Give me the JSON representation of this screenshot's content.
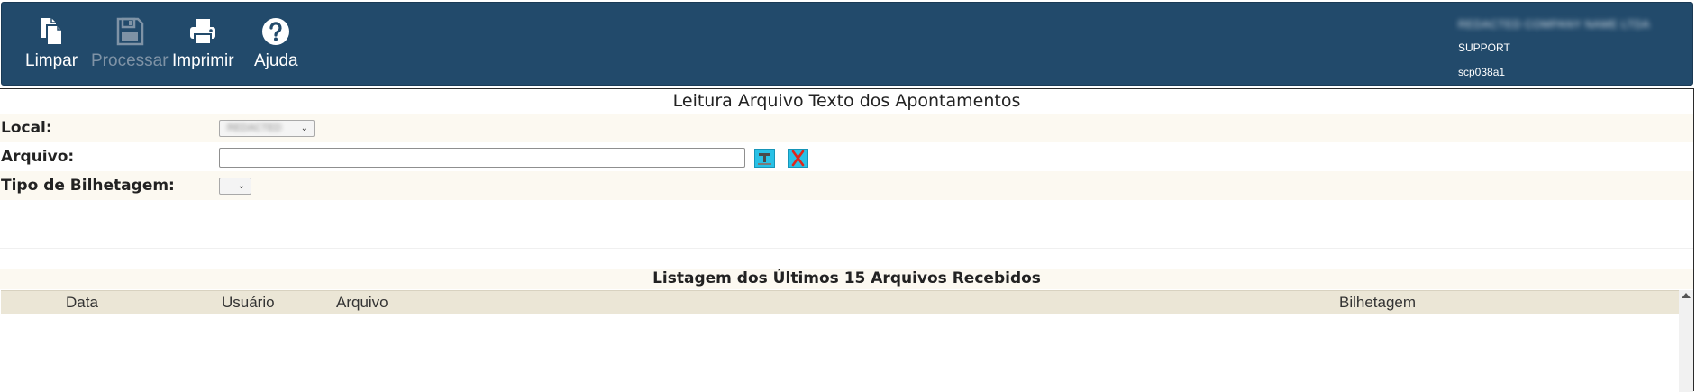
{
  "toolbar": {
    "buttons": [
      {
        "label": "Limpar",
        "icon": "document-copy-icon",
        "enabled": true
      },
      {
        "label": "Processar",
        "icon": "floppy-disk-icon",
        "enabled": false
      },
      {
        "label": "Imprimir",
        "icon": "printer-icon",
        "enabled": true
      },
      {
        "label": "Ajuda",
        "icon": "question-circle-icon",
        "enabled": true
      }
    ]
  },
  "user": {
    "company": "REDACTED COMPANY NAME LTDA",
    "role": "SUPPORT",
    "program": "scp038a1"
  },
  "form": {
    "title": "Leitura Arquivo Texto dos Apontamentos",
    "local": {
      "label": "Local:",
      "value": "REDACTED"
    },
    "arquivo": {
      "label": "Arquivo:",
      "value": "",
      "upload_icon": "upload-icon",
      "clear_icon": "red-x-icon"
    },
    "tipo": {
      "label": "Tipo de Bilhetagem:",
      "value": ""
    }
  },
  "list": {
    "title": "Listagem dos Últimos 15 Arquivos Recebidos",
    "columns": [
      "Data",
      "Usuário",
      "Arquivo",
      "Bilhetagem"
    ],
    "rows": []
  },
  "colors": {
    "header_bg": "#224a6b",
    "row_alt_bg": "#fcf9f1",
    "list_header_bg": "#ebe6d6",
    "icon_button_bg": "#29c1e6",
    "clear_x": "#e0261b"
  }
}
